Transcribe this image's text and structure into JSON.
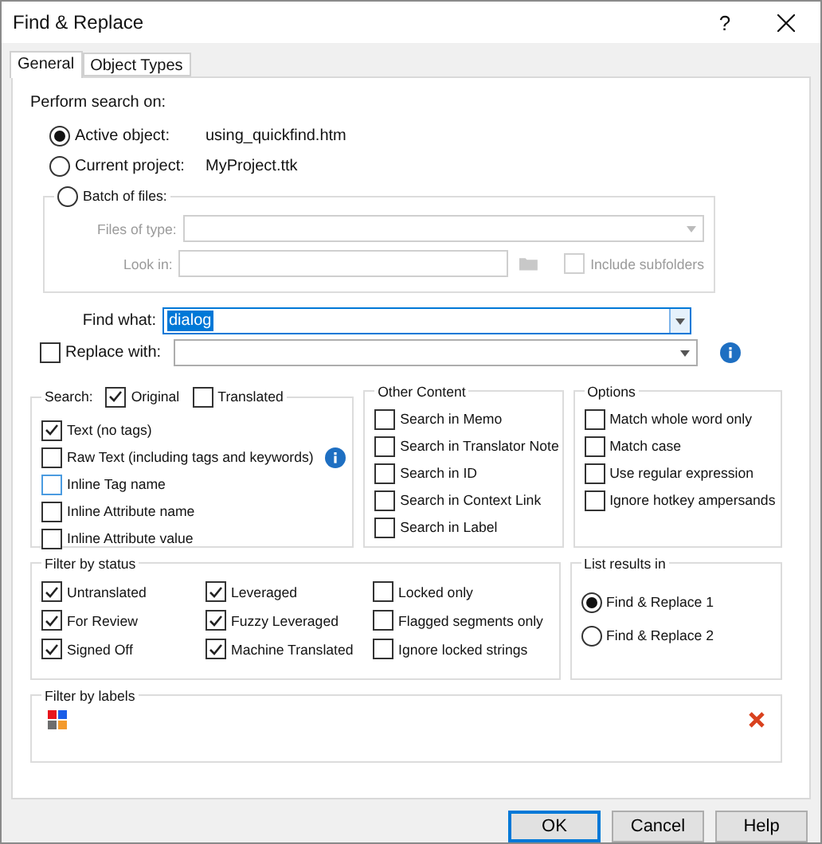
{
  "window": {
    "title": "Find & Replace",
    "help": "?"
  },
  "tabs": [
    {
      "label": "General",
      "selected": true
    },
    {
      "label": "Object Types",
      "selected": false
    }
  ],
  "perform_search": {
    "label": "Perform search on:",
    "options": [
      {
        "label": "Active object:",
        "value": "using_quickfind.htm",
        "selected": true
      },
      {
        "label": "Current project:",
        "value": "MyProject.ttk",
        "selected": false
      },
      {
        "label": "Batch of files:",
        "selected": false
      }
    ],
    "batch": {
      "disabled": true,
      "files_of_type": "Files of type:",
      "look_in": "Look in:",
      "include_subfolders": {
        "label": "Include subfolders",
        "checked": false
      }
    }
  },
  "find_what": {
    "label": "Find what:",
    "value": "dialog"
  },
  "replace_with": {
    "label": "Replace with:",
    "checked": false
  },
  "search": {
    "label": "Search:",
    "original": {
      "label": "Original",
      "checked": true
    },
    "translated": {
      "label": "Translated",
      "checked": false
    },
    "items": [
      {
        "label": "Text (no tags)",
        "checked": true,
        "focused": false,
        "has_info": false
      },
      {
        "label": "Raw Text (including tags and keywords)",
        "checked": false,
        "focused": false,
        "has_info": true
      },
      {
        "label": "Inline Tag name",
        "checked": false,
        "focused": true,
        "has_info": false
      },
      {
        "label": "Inline Attribute name",
        "checked": false,
        "focused": false,
        "has_info": false
      },
      {
        "label": "Inline Attribute value",
        "checked": false,
        "focused": false,
        "has_info": false
      }
    ]
  },
  "other_content": {
    "label": "Other Content",
    "items": [
      {
        "label": "Search in Memo",
        "checked": false
      },
      {
        "label": "Search in Translator Note",
        "checked": false
      },
      {
        "label": "Search in ID",
        "checked": false
      },
      {
        "label": "Search in Context Link",
        "checked": false
      },
      {
        "label": "Search in Label",
        "checked": false
      }
    ]
  },
  "options": {
    "label": "Options",
    "items": [
      {
        "label": "Match whole word only",
        "checked": false
      },
      {
        "label": "Match case",
        "checked": false
      },
      {
        "label": "Use regular expression",
        "checked": false
      },
      {
        "label": "Ignore hotkey ampersands",
        "checked": false
      }
    ]
  },
  "filter_by_status": {
    "label": "Filter by status",
    "items": [
      {
        "label": "Untranslated",
        "checked": true
      },
      {
        "label": "For Review",
        "checked": true
      },
      {
        "label": "Signed Off",
        "checked": true
      },
      {
        "label": "Leveraged",
        "checked": true
      },
      {
        "label": "Fuzzy Leveraged",
        "checked": true
      },
      {
        "label": "Machine Translated",
        "checked": true
      },
      {
        "label": "Locked only",
        "checked": false
      },
      {
        "label": "Flagged segments only",
        "checked": false
      },
      {
        "label": "Ignore locked strings",
        "checked": false
      }
    ]
  },
  "list_results": {
    "label": "List results in",
    "options": [
      {
        "label": "Find & Replace 1",
        "selected": true
      },
      {
        "label": "Find & Replace 2",
        "selected": false
      }
    ]
  },
  "filter_by_labels": {
    "label": "Filter by labels"
  },
  "buttons": [
    {
      "label": "OK",
      "default": true
    },
    {
      "label": "Cancel",
      "default": false
    },
    {
      "label": "Help",
      "default": false
    }
  ]
}
